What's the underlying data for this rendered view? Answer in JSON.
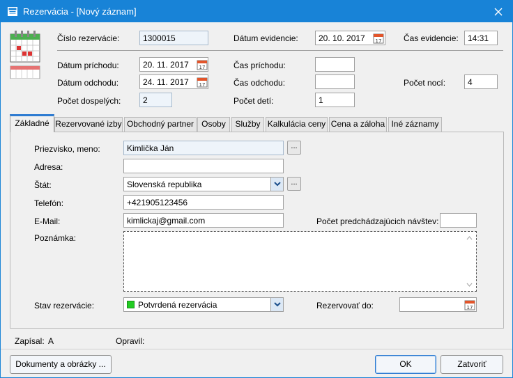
{
  "window": {
    "title": "Rezervácia - [Nový záznam]"
  },
  "header": {
    "reservation_number": {
      "label": "Číslo rezervácie:",
      "value": "1300015"
    },
    "record_date": {
      "label": "Dátum evidencie:",
      "value": "20. 10. 2017"
    },
    "record_time": {
      "label": "Čas evidencie:",
      "value": "14:31"
    },
    "arrival_date": {
      "label": "Dátum príchodu:",
      "value": "20. 11. 2017"
    },
    "arrival_time": {
      "label": "Čas príchodu:",
      "value": ""
    },
    "departure_date": {
      "label": "Dátum odchodu:",
      "value": "24. 11. 2017"
    },
    "departure_time": {
      "label": "Čas odchodu:",
      "value": ""
    },
    "nights": {
      "label": "Počet nocí:",
      "value": "4"
    },
    "adults": {
      "label": "Počet dospelých:",
      "value": "2"
    },
    "children": {
      "label": "Počet detí:",
      "value": "1"
    }
  },
  "tabs": [
    {
      "label": "Základné",
      "active": true
    },
    {
      "label": "Rezervované izby"
    },
    {
      "label": "Obchodný partner"
    },
    {
      "label": "Osoby"
    },
    {
      "label": "Služby"
    },
    {
      "label": "Kalkulácia ceny"
    },
    {
      "label": "Cena a záloha"
    },
    {
      "label": "Iné záznamy"
    }
  ],
  "basic": {
    "name": {
      "label": "Priezvisko, meno:",
      "value": "Kimlička Ján",
      "button": "..."
    },
    "address": {
      "label": "Adresa:",
      "value": ""
    },
    "country": {
      "label": "Štát:",
      "value": "Slovenská republika",
      "button": "..."
    },
    "phone": {
      "label": "Telefón:",
      "value": "+421905123456"
    },
    "email": {
      "label": "E-Mail:",
      "value": "kimlickaj@gmail.com"
    },
    "previous_visits": {
      "label": "Počet predchádzajúcich návštev:",
      "value": ""
    },
    "note": {
      "label": "Poznámka:",
      "value": ""
    },
    "status": {
      "label": "Stav rezervácie:",
      "value": "Potvrdená rezervácia",
      "color": "#22cc22"
    },
    "reserve_until": {
      "label": "Rezervovať do:",
      "value": ""
    }
  },
  "footer": {
    "written_by_label": "Zapísal:",
    "written_by_value": "A",
    "edited_by_label": "Opravil:",
    "edited_by_value": "",
    "documents_button": "Dokumenty a obrázky ...",
    "ok_button": "OK",
    "close_button": "Zatvoriť"
  },
  "colors": {
    "titlebar": "#1883d7",
    "active_tab": "#2d7bd1"
  }
}
